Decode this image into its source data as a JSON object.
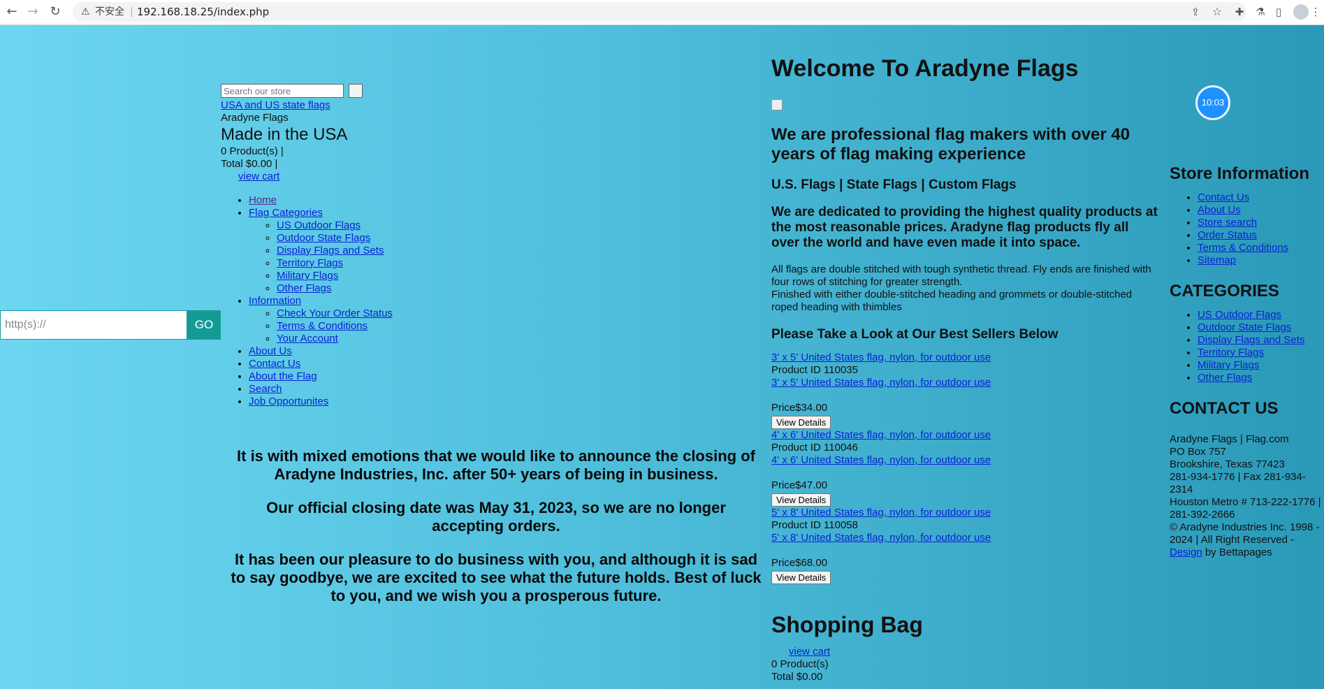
{
  "browser": {
    "insecure_label": "不安全",
    "url": "192.168.18.25/index.php"
  },
  "urlbar": {
    "placeholder": "http(s)://",
    "go": "GO"
  },
  "header": {
    "search_placeholder": "Search our store",
    "logo_alt": "USA and US state flags",
    "brand": "Aradyne Flags",
    "made": "Made in the USA",
    "products": "0 Product(s) |",
    "total": "Total $0.00 |",
    "view_cart": "view cart"
  },
  "menu": {
    "home": "Home",
    "flag_categories": "Flag Categories",
    "categories": [
      "US Outdoor Flags",
      "Outdoor State Flags",
      "Display Flags and Sets",
      "Territory Flags",
      "Military Flags",
      "Other Flags"
    ],
    "information": "Information",
    "info_items": [
      "Check Your Order Status",
      "Terms & Conditions",
      "Your Account"
    ],
    "about_us": "About Us",
    "contact_us": "Contact Us",
    "about_flag": "About the Flag",
    "search": "Search",
    "jobs": "Job Opportunites"
  },
  "notice": {
    "p1": "It is with mixed emotions that we would like to announce the closing of Aradyne Industries, Inc. after 50+ years of being in business.",
    "p2": "Our official closing date was May 31, 2023, so we are no longer accepting orders.",
    "p3": "It has been our pleasure to do business with you, and although it is sad to say goodbye, we are excited to see what the future holds. Best of luck to you, and we wish you a prosperous future."
  },
  "main": {
    "welcome": "Welcome To Aradyne Flags",
    "pro": "We are professional flag makers with over 40 years of flag making experience",
    "types": "U.S. Flags | State Flags | Custom Flags",
    "dedicated": "We are dedicated to providing the highest quality products at the most reasonable prices. Aradyne flag products fly all over the world and have even made it into space.",
    "desc1": "All flags are double stitched with tough synthetic thread. Fly ends are finished with four rows of stitching for greater strength.",
    "desc2": "Finished with either double-stitched heading and grommets or double-stitched roped heading with thimbles",
    "best": "Please Take a Look at Our Best Sellers Below",
    "view_details": "View Details",
    "products": [
      {
        "name": "3' x 5' United States flag, nylon, for outdoor use",
        "id": "Product ID 110035",
        "price": "Price$34.00"
      },
      {
        "name": "4' x 6' United States flag, nylon, for outdoor use",
        "id": "Product ID 110046",
        "price": "Price$47.00"
      },
      {
        "name": "5' x 8' United States flag, nylon, for outdoor use",
        "id": "Product ID 110058",
        "price": "Price$68.00"
      }
    ],
    "bag_title": "Shopping Bag",
    "bag_view_cart": "view cart",
    "bag_products": "0 Product(s)",
    "bag_total": "Total $0.00"
  },
  "clock": "10:03",
  "store_info": {
    "title": "Store Information",
    "links": [
      "Contact Us",
      "About Us",
      "Store search",
      "Order Status",
      "Terms & Conditions",
      "Sitemap"
    ]
  },
  "categories_side": {
    "title": "CATEGORIES",
    "links": [
      "US Outdoor Flags",
      "Outdoor State Flags",
      "Display Flags and Sets",
      "Territory Flags",
      "Military Flags",
      "Other Flags"
    ]
  },
  "contact": {
    "title": "CONTACT US",
    "l1": "Aradyne Flags | Flag.com",
    "l2": "PO Box 757",
    "l3": "Brookshire, Texas 77423",
    "l4": "281-934-1776 | Fax 281-934-2314",
    "l5": "Houston Metro # 713-222-1776 | 281-392-2666",
    "l6": "© Aradyne Industries Inc. 1998 - 2024 | All Right Reserved -",
    "design": "Design",
    "by": " by Bettapages"
  }
}
